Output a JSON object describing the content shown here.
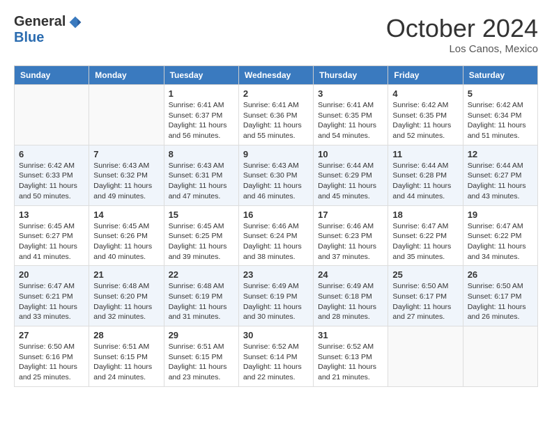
{
  "header": {
    "logo_general": "General",
    "logo_blue": "Blue",
    "month_title": "October 2024",
    "location": "Los Canos, Mexico"
  },
  "weekdays": [
    "Sunday",
    "Monday",
    "Tuesday",
    "Wednesday",
    "Thursday",
    "Friday",
    "Saturday"
  ],
  "weeks": [
    [
      {
        "day": "",
        "info": ""
      },
      {
        "day": "",
        "info": ""
      },
      {
        "day": "1",
        "info": "Sunrise: 6:41 AM\nSunset: 6:37 PM\nDaylight: 11 hours and 56 minutes."
      },
      {
        "day": "2",
        "info": "Sunrise: 6:41 AM\nSunset: 6:36 PM\nDaylight: 11 hours and 55 minutes."
      },
      {
        "day": "3",
        "info": "Sunrise: 6:41 AM\nSunset: 6:35 PM\nDaylight: 11 hours and 54 minutes."
      },
      {
        "day": "4",
        "info": "Sunrise: 6:42 AM\nSunset: 6:35 PM\nDaylight: 11 hours and 52 minutes."
      },
      {
        "day": "5",
        "info": "Sunrise: 6:42 AM\nSunset: 6:34 PM\nDaylight: 11 hours and 51 minutes."
      }
    ],
    [
      {
        "day": "6",
        "info": "Sunrise: 6:42 AM\nSunset: 6:33 PM\nDaylight: 11 hours and 50 minutes."
      },
      {
        "day": "7",
        "info": "Sunrise: 6:43 AM\nSunset: 6:32 PM\nDaylight: 11 hours and 49 minutes."
      },
      {
        "day": "8",
        "info": "Sunrise: 6:43 AM\nSunset: 6:31 PM\nDaylight: 11 hours and 47 minutes."
      },
      {
        "day": "9",
        "info": "Sunrise: 6:43 AM\nSunset: 6:30 PM\nDaylight: 11 hours and 46 minutes."
      },
      {
        "day": "10",
        "info": "Sunrise: 6:44 AM\nSunset: 6:29 PM\nDaylight: 11 hours and 45 minutes."
      },
      {
        "day": "11",
        "info": "Sunrise: 6:44 AM\nSunset: 6:28 PM\nDaylight: 11 hours and 44 minutes."
      },
      {
        "day": "12",
        "info": "Sunrise: 6:44 AM\nSunset: 6:27 PM\nDaylight: 11 hours and 43 minutes."
      }
    ],
    [
      {
        "day": "13",
        "info": "Sunrise: 6:45 AM\nSunset: 6:27 PM\nDaylight: 11 hours and 41 minutes."
      },
      {
        "day": "14",
        "info": "Sunrise: 6:45 AM\nSunset: 6:26 PM\nDaylight: 11 hours and 40 minutes."
      },
      {
        "day": "15",
        "info": "Sunrise: 6:45 AM\nSunset: 6:25 PM\nDaylight: 11 hours and 39 minutes."
      },
      {
        "day": "16",
        "info": "Sunrise: 6:46 AM\nSunset: 6:24 PM\nDaylight: 11 hours and 38 minutes."
      },
      {
        "day": "17",
        "info": "Sunrise: 6:46 AM\nSunset: 6:23 PM\nDaylight: 11 hours and 37 minutes."
      },
      {
        "day": "18",
        "info": "Sunrise: 6:47 AM\nSunset: 6:22 PM\nDaylight: 11 hours and 35 minutes."
      },
      {
        "day": "19",
        "info": "Sunrise: 6:47 AM\nSunset: 6:22 PM\nDaylight: 11 hours and 34 minutes."
      }
    ],
    [
      {
        "day": "20",
        "info": "Sunrise: 6:47 AM\nSunset: 6:21 PM\nDaylight: 11 hours and 33 minutes."
      },
      {
        "day": "21",
        "info": "Sunrise: 6:48 AM\nSunset: 6:20 PM\nDaylight: 11 hours and 32 minutes."
      },
      {
        "day": "22",
        "info": "Sunrise: 6:48 AM\nSunset: 6:19 PM\nDaylight: 11 hours and 31 minutes."
      },
      {
        "day": "23",
        "info": "Sunrise: 6:49 AM\nSunset: 6:19 PM\nDaylight: 11 hours and 30 minutes."
      },
      {
        "day": "24",
        "info": "Sunrise: 6:49 AM\nSunset: 6:18 PM\nDaylight: 11 hours and 28 minutes."
      },
      {
        "day": "25",
        "info": "Sunrise: 6:50 AM\nSunset: 6:17 PM\nDaylight: 11 hours and 27 minutes."
      },
      {
        "day": "26",
        "info": "Sunrise: 6:50 AM\nSunset: 6:17 PM\nDaylight: 11 hours and 26 minutes."
      }
    ],
    [
      {
        "day": "27",
        "info": "Sunrise: 6:50 AM\nSunset: 6:16 PM\nDaylight: 11 hours and 25 minutes."
      },
      {
        "day": "28",
        "info": "Sunrise: 6:51 AM\nSunset: 6:15 PM\nDaylight: 11 hours and 24 minutes."
      },
      {
        "day": "29",
        "info": "Sunrise: 6:51 AM\nSunset: 6:15 PM\nDaylight: 11 hours and 23 minutes."
      },
      {
        "day": "30",
        "info": "Sunrise: 6:52 AM\nSunset: 6:14 PM\nDaylight: 11 hours and 22 minutes."
      },
      {
        "day": "31",
        "info": "Sunrise: 6:52 AM\nSunset: 6:13 PM\nDaylight: 11 hours and 21 minutes."
      },
      {
        "day": "",
        "info": ""
      },
      {
        "day": "",
        "info": ""
      }
    ]
  ]
}
